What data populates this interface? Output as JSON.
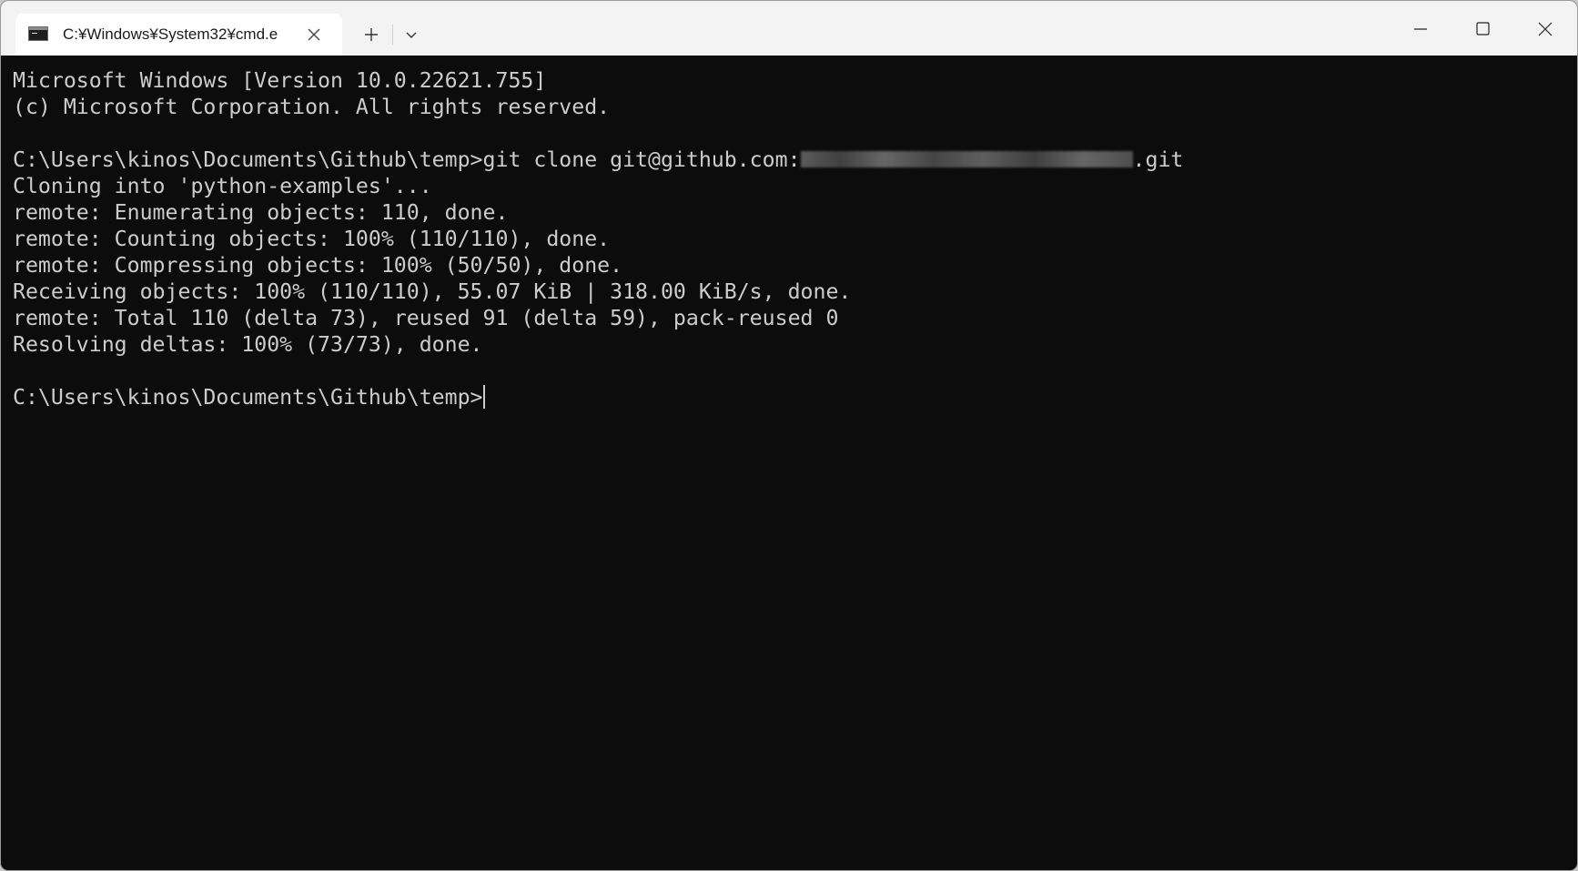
{
  "window": {
    "tab_title": "C:¥Windows¥System32¥cmd.e"
  },
  "icons": {
    "tab_icon": "cmd-terminal-icon",
    "tab_close": "close-icon",
    "new_tab": "plus-icon",
    "dropdown": "chevron-down-icon",
    "minimize": "minimize-icon",
    "maximize": "maximize-icon",
    "close": "close-icon"
  },
  "colors": {
    "terminal_bg": "#0c0c0c",
    "terminal_fg": "#cccccc",
    "titlebar_bg": "#f3f3f3",
    "tab_bg": "#ffffff"
  },
  "terminal": {
    "lines": [
      "Microsoft Windows [Version 10.0.22621.755]",
      "(c) Microsoft Corporation. All rights reserved.",
      "",
      "",
      "Cloning into 'python-examples'...",
      "remote: Enumerating objects: 110, done.",
      "remote: Counting objects: 100% (110/110), done.",
      "remote: Compressing objects: 100% (50/50), done.",
      "Receiving objects: 100% (110/110), 55.07 KiB | 318.00 KiB/s, done.",
      "remote: Total 110 (delta 73), reused 91 (delta 59), pack-reused 0",
      "Resolving deltas: 100% (73/73), done.",
      ""
    ],
    "clone_command_prefix": "C:\\Users\\kinos\\Documents\\Github\\temp>git clone git@github.com:",
    "clone_command_suffix": ".git",
    "prompt": "C:\\Users\\kinos\\Documents\\Github\\temp>"
  }
}
